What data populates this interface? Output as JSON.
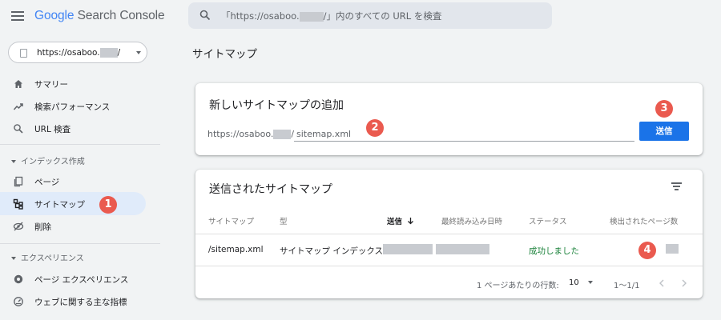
{
  "header": {
    "logo_google": "Google",
    "logo_rest": " Search Console",
    "search_placeholder_pre": "「https://osaboo.",
    "search_placeholder_post": "/」内のすべての URL を検査"
  },
  "property": {
    "url_pre": "https://osaboo.",
    "url_post": "/"
  },
  "sidebar": {
    "items": [
      {
        "label": "サマリー",
        "icon": "home-icon"
      },
      {
        "label": "検索パフォーマンス",
        "icon": "trending-up-icon"
      },
      {
        "label": "URL 検査",
        "icon": "search-icon"
      }
    ],
    "section_index": "インデックス作成",
    "index_items": [
      {
        "label": "ページ",
        "icon": "pages-icon"
      },
      {
        "label": "サイトマップ",
        "icon": "sitemap-icon",
        "active": true
      },
      {
        "label": "削除",
        "icon": "removals-icon"
      }
    ],
    "section_experience": "エクスペリエンス",
    "experience_items": [
      {
        "label": "ページ エクスペリエンス",
        "icon": "page-experience-icon"
      },
      {
        "label": "ウェブに関する主な指標",
        "icon": "core-web-vitals-icon"
      }
    ]
  },
  "main": {
    "page_title": "サイトマップ",
    "add_card": {
      "title": "新しいサイトマップの追加",
      "prefix_pre": "https://osaboo.",
      "prefix_post": "/",
      "input_value": "sitemap.xml",
      "submit_label": "送信"
    },
    "submitted_card": {
      "title": "送信されたサイトマップ",
      "columns": [
        "サイトマップ",
        "型",
        "送信",
        "最終読み込み日時",
        "ステータス",
        "検出されたページ数"
      ],
      "rows": [
        {
          "sitemap": "/sitemap.xml",
          "type": "サイトマップ インデックス",
          "status": "成功しました"
        }
      ],
      "rows_per_page_label": "1 ページあたりの行数:",
      "rows_per_page_value": "10",
      "range": "1〜1/1"
    }
  },
  "badges": [
    "1",
    "2",
    "3",
    "4"
  ],
  "colors": {
    "accent": "#1a73e8",
    "active_bg": "#e0ebfa",
    "success": "#188038",
    "badge": "#ea5a4f"
  }
}
